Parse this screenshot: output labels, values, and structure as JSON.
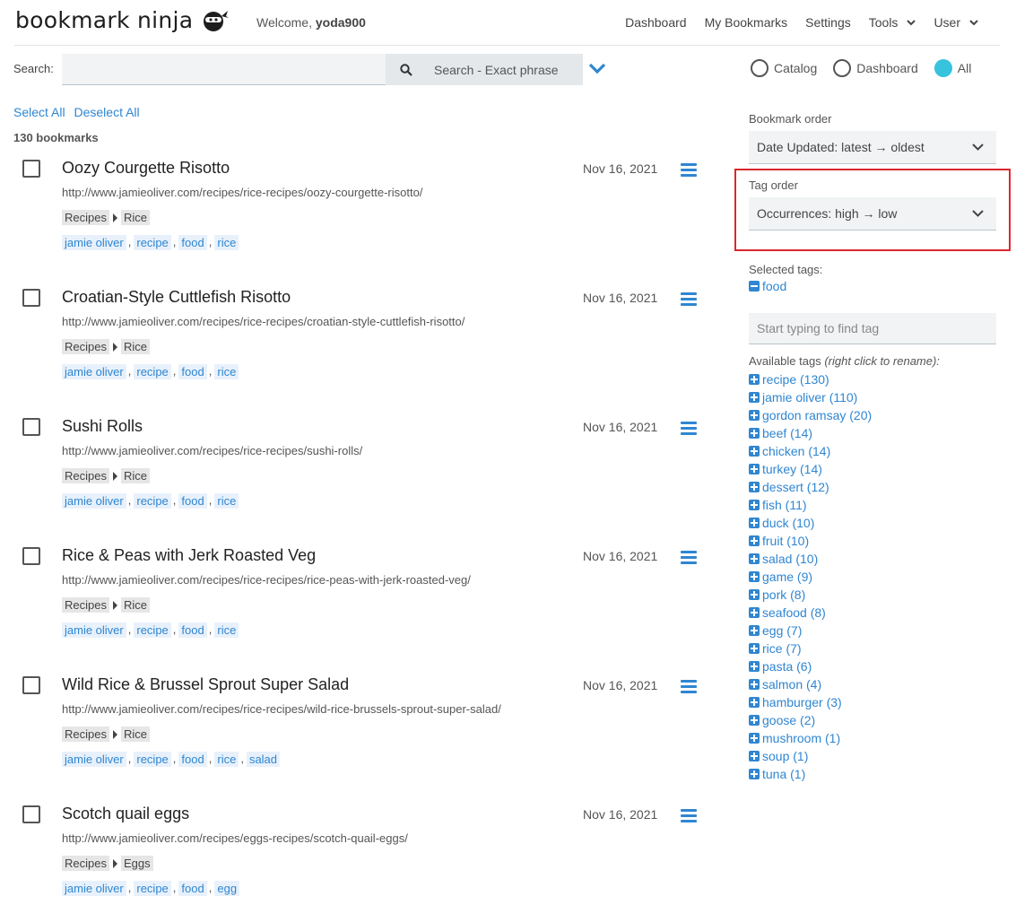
{
  "header": {
    "logo": "bookmark ninja",
    "welcome_prefix": "Welcome, ",
    "username": "yoda900",
    "nav": [
      "Dashboard",
      "My Bookmarks",
      "Settings",
      "Tools",
      "User"
    ]
  },
  "search": {
    "label": "Search:",
    "value": "",
    "placeholder": "",
    "button_label": "Search - Exact phrase"
  },
  "scope": {
    "options": [
      "Catalog",
      "Dashboard",
      "All"
    ],
    "selected": "All"
  },
  "selection": {
    "select_all": "Select All",
    "deselect_all": "Deselect All",
    "count": "130 bookmarks"
  },
  "bookmarks": [
    {
      "title": "Oozy Courgette Risotto",
      "date": "Nov 16, 2021",
      "url": "http://www.jamieoliver.com/recipes/rice-recipes/oozy-courgette-risotto/",
      "category": [
        "Recipes",
        "Rice"
      ],
      "tags": [
        "jamie oliver",
        "recipe",
        "food",
        "rice"
      ]
    },
    {
      "title": "Croatian-Style Cuttlefish Risotto",
      "date": "Nov 16, 2021",
      "url": "http://www.jamieoliver.com/recipes/rice-recipes/croatian-style-cuttlefish-risotto/",
      "category": [
        "Recipes",
        "Rice"
      ],
      "tags": [
        "jamie oliver",
        "recipe",
        "food",
        "rice"
      ]
    },
    {
      "title": "Sushi Rolls",
      "date": "Nov 16, 2021",
      "url": "http://www.jamieoliver.com/recipes/rice-recipes/sushi-rolls/",
      "category": [
        "Recipes",
        "Rice"
      ],
      "tags": [
        "jamie oliver",
        "recipe",
        "food",
        "rice"
      ]
    },
    {
      "title": "Rice & Peas with Jerk Roasted Veg",
      "date": "Nov 16, 2021",
      "url": "http://www.jamieoliver.com/recipes/rice-recipes/rice-peas-with-jerk-roasted-veg/",
      "category": [
        "Recipes",
        "Rice"
      ],
      "tags": [
        "jamie oliver",
        "recipe",
        "food",
        "rice"
      ]
    },
    {
      "title": "Wild Rice & Brussel Sprout Super Salad",
      "date": "Nov 16, 2021",
      "url": "http://www.jamieoliver.com/recipes/rice-recipes/wild-rice-brussels-sprout-super-salad/",
      "category": [
        "Recipes",
        "Rice"
      ],
      "tags": [
        "jamie oliver",
        "recipe",
        "food",
        "rice",
        "salad"
      ]
    },
    {
      "title": "Scotch quail eggs",
      "date": "Nov 16, 2021",
      "url": "http://www.jamieoliver.com/recipes/eggs-recipes/scotch-quail-eggs/",
      "category": [
        "Recipes",
        "Eggs"
      ],
      "tags": [
        "jamie oliver",
        "recipe",
        "food",
        "egg"
      ]
    }
  ],
  "sidebar": {
    "bookmark_order_label": "Bookmark order",
    "bookmark_order_value": "Date Updated: latest → oldest",
    "tag_order_label": "Tag order",
    "tag_order_value": "Occurrences: high → low",
    "selected_tags_label": "Selected tags:",
    "selected_tags": [
      "food"
    ],
    "tag_search_placeholder": "Start typing to find tag",
    "available_label": "Available tags ",
    "available_hint": "(right click to rename):",
    "available_tags": [
      "recipe (130)",
      "jamie oliver (110)",
      "gordon ramsay (20)",
      "beef (14)",
      "chicken (14)",
      "turkey (14)",
      "dessert (12)",
      "fish (11)",
      "duck (10)",
      "fruit (10)",
      "salad (10)",
      "game (9)",
      "pork (8)",
      "seafood (8)",
      "egg (7)",
      "rice (7)",
      "pasta (6)",
      "salmon (4)",
      "hamburger (3)",
      "goose (2)",
      "mushroom (1)",
      "soup (1)",
      "tuna (1)"
    ]
  },
  "colors": {
    "accent": "#2f86d1",
    "radio_selected": "#37c2dd",
    "highlight": "#d9272e"
  }
}
